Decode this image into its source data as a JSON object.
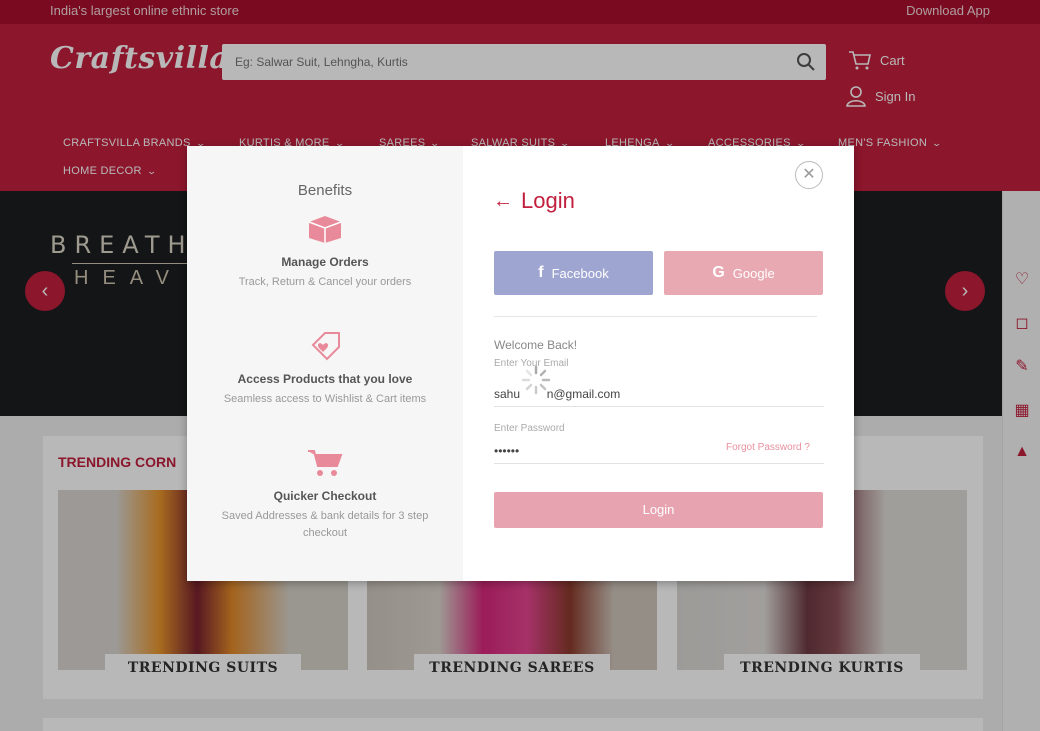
{
  "topbar": {
    "tagline": "India's largest online ethnic store",
    "download": "Download App"
  },
  "header": {
    "logo": "Craftsvilla",
    "search_placeholder": "Eg: Salwar Suit, Lehngha, Kurtis",
    "cart": "Cart",
    "signin": "Sign In"
  },
  "nav": {
    "row1": [
      "CRAFTSVILLA BRANDS",
      "KURTIS & MORE",
      "SAREES",
      "SALWAR SUITS",
      "LEHENGA",
      "ACCESSORIES",
      "MEN'S FASHION"
    ],
    "row2": [
      "HOME DECOR"
    ]
  },
  "banner": {
    "headline": "BREATH",
    "subline": "HEAV"
  },
  "trending": {
    "title": "TRENDING CORN",
    "cards": [
      "TRENDING SUITS",
      "TRENDING SAREES",
      "TRENDING KURTIS"
    ]
  },
  "rail": {
    "icons": [
      "heart-icon",
      "shopping-bag-icon",
      "shoe-icon",
      "qr-code-icon",
      "tower-icon"
    ]
  },
  "modal": {
    "benefits_title": "Benefits",
    "benefits": [
      {
        "title": "Manage Orders",
        "desc": "Track, Return & Cancel your orders",
        "icon": "box-icon"
      },
      {
        "title": "Access Products that you love",
        "desc": "Seamless access to Wishlist & Cart items",
        "icon": "tag-heart-icon"
      },
      {
        "title": "Quicker Checkout",
        "desc": "Saved Addresses & bank details for 3 step checkout",
        "icon": "cart-icon"
      }
    ],
    "login_title": "Login",
    "facebook": "Facebook",
    "google": "Google",
    "welcome": "Welcome Back!",
    "email_label": "Enter Your Email",
    "email_value": "sahu        n@gmail.com",
    "password_label": "Enter Password",
    "password_value": "••••••",
    "forgot": "Forgot Password ?",
    "login_button": "Login"
  },
  "colors": {
    "brand": "#c21f3e",
    "topbar": "#a90e2b",
    "facebook": "#9ea5d1",
    "google": "#e9a9b2",
    "login": "#e8a3b0"
  }
}
